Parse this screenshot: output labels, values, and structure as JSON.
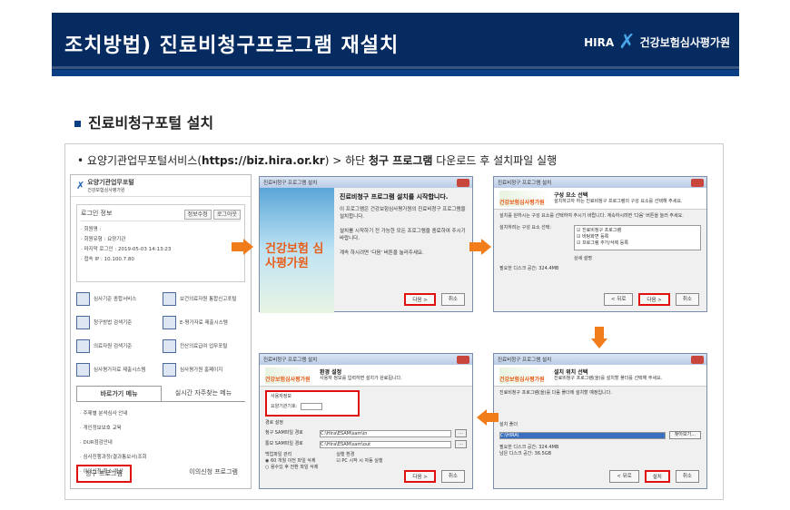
{
  "header": {
    "title": "조치방법) 진료비청구프로그램 재설치",
    "logo_text": "HIRA",
    "org_name": "건강보험심사평가원"
  },
  "section": {
    "title": "진료비청구포털 설치"
  },
  "lead": {
    "bullet": "•",
    "pre": "요양기관업무포털서비스(",
    "url": "https://biz.hira.or.kr",
    "mid": ") > 하단 ",
    "bold": "청구 프로그램",
    "post": " 다운로드 후 설치파일 실행"
  },
  "portal": {
    "title": "요양기관업무포털",
    "subtitle": "건강보험심사평가원",
    "login_label": "로그인 정보",
    "btn1": "정보수정",
    "btn2": "로그아웃",
    "info": [
      "· 회원명 :",
      "· 회원유형 : 요양기관",
      "· 마지막 로그인 : 2019-05-03 14:13:23",
      "· 접속 IP : 10.100.7.80"
    ],
    "menu": [
      "심사기준 종합서비스",
      "보건의료자원 통합신고포털",
      "청구방법 검색기준",
      "E-평가자료 제출시스템",
      "의료자원 검색기준",
      "전산의료급여 업무포털",
      "심사평가자료 제출시스템",
      "심사평가원 홈페이지"
    ],
    "tab_active": "바로가기 메뉴",
    "tab_other": "실시간 자주찾는 메뉴",
    "links": [
      "· 주제별 분석심사 안내",
      "· 개인정보보호 교육",
      "· DUR점검안내",
      "· 심사진행과정(결과통보서)조회",
      "· 이의신청/취소/정산"
    ],
    "footer_left": "청구 프로그램",
    "footer_right": "이의신청 프로그램"
  },
  "dialog1": {
    "bar": "진료비청구 프로그램 설치",
    "title": "진료비청구 프로그램 설치를 시작합니다.",
    "p1": "이 프로그램은 건강보험심사평가원의 진료비청구 프로그램을 설치합니다.",
    "p2": "설치를 시작하기 전 가능한 모든 프로그램을 종료하여 주시기 바랍니다.",
    "p3": "계속 하시려면 '다음' 버튼을 눌러주세요.",
    "logo": "건강보험 심사평가원",
    "next": "다음 >",
    "cancel": "취소"
  },
  "dialog2": {
    "bar": "진료비청구 프로그램 설치",
    "htitle": "구성 요소 선택",
    "hsub": "설치하고자 하는 진료비청구 프로그램의 구성 요소를 선택해 주세요.",
    "p1": "설치를 원하시는 구성 요소를 선택하여 주시기 바랍니다. 계속하시려면 '다음' 버튼을 눌러 주세요.",
    "label": "설치하려는 구성 요소 선택:",
    "items": [
      "진료비청구 프로그램",
      "바탕화면 등록",
      "프로그램 추가/삭제 등록"
    ],
    "desc": "상세 설명",
    "space": "필요한 디스크 공간: 324.4MB",
    "back": "< 뒤로",
    "next": "다음 >",
    "cancel": "취소",
    "logo": "건강보험심사평가원"
  },
  "dialog3": {
    "bar": "진료비청구 프로그램 설치",
    "htitle": "설치 위치 선택",
    "hsub": "진료비청구 프로그램(을)를 설치할 폴더를 선택해 주세요.",
    "p1": "진료비청구 프로그램(을)를 다음 폴더에 설치할 예정입니다.",
    "folder_label": "설치 폴더",
    "folder": "C:\\HIRA\\",
    "browse": "찾아보기...",
    "space1": "필요한 디스크 공간: 324.4MB",
    "space2": "남은 디스크 공간: 36.5GB",
    "back": "< 뒤로",
    "install": "설치",
    "cancel": "취소",
    "logo": "건강보험심사평가원"
  },
  "dialog4": {
    "bar": "진료비청구 프로그램 설치",
    "htitle": "환경 설정",
    "hsub": "사용자 정보를 입력하면 설치가 완료됩니다.",
    "user_label": "사용자정보",
    "code_label": "요양기관기호:",
    "env_label": "경로 설정",
    "send_label": "청구 SAM파일 경로",
    "send_path": "C:\\Hira\\ESAM\\sam\\in",
    "recv_label": "통보 SAM파일 경로",
    "recv_path": "C:\\Hira\\ESAM\\sam\\out",
    "backup_label": "백업파일 관리",
    "opt1": "60  개월 이전 파일 삭제",
    "opt2": "용수있 후 전환 파일 삭제",
    "install_env": "실행 환경",
    "chk": "PC 시작 시 자동 실행",
    "next": "다음 >",
    "cancel": "취소",
    "logo": "건강보험심사평가원"
  }
}
